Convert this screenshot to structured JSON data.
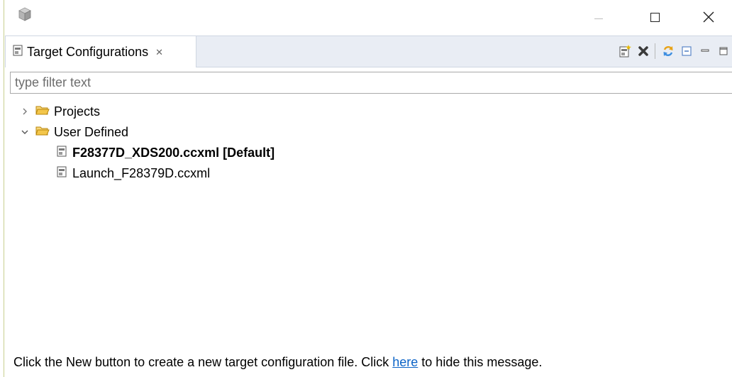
{
  "view": {
    "tab_title": "Target Configurations",
    "filter_placeholder": "type filter text",
    "filter_value": ""
  },
  "tree": {
    "projects_label": "Projects",
    "user_defined_label": "User Defined",
    "items": [
      {
        "label": "F28377D_XDS200.ccxml [Default]",
        "bold": true
      },
      {
        "label": "Launch_F28379D.ccxml",
        "bold": false
      }
    ]
  },
  "message": {
    "before": "Click the New button to create a new target configuration file. Click ",
    "link": "here",
    "after": " to hide this message."
  },
  "colors": {
    "tab_row": "#e9edf4",
    "folder": "#f3c64b",
    "link": "#0b63c7"
  }
}
